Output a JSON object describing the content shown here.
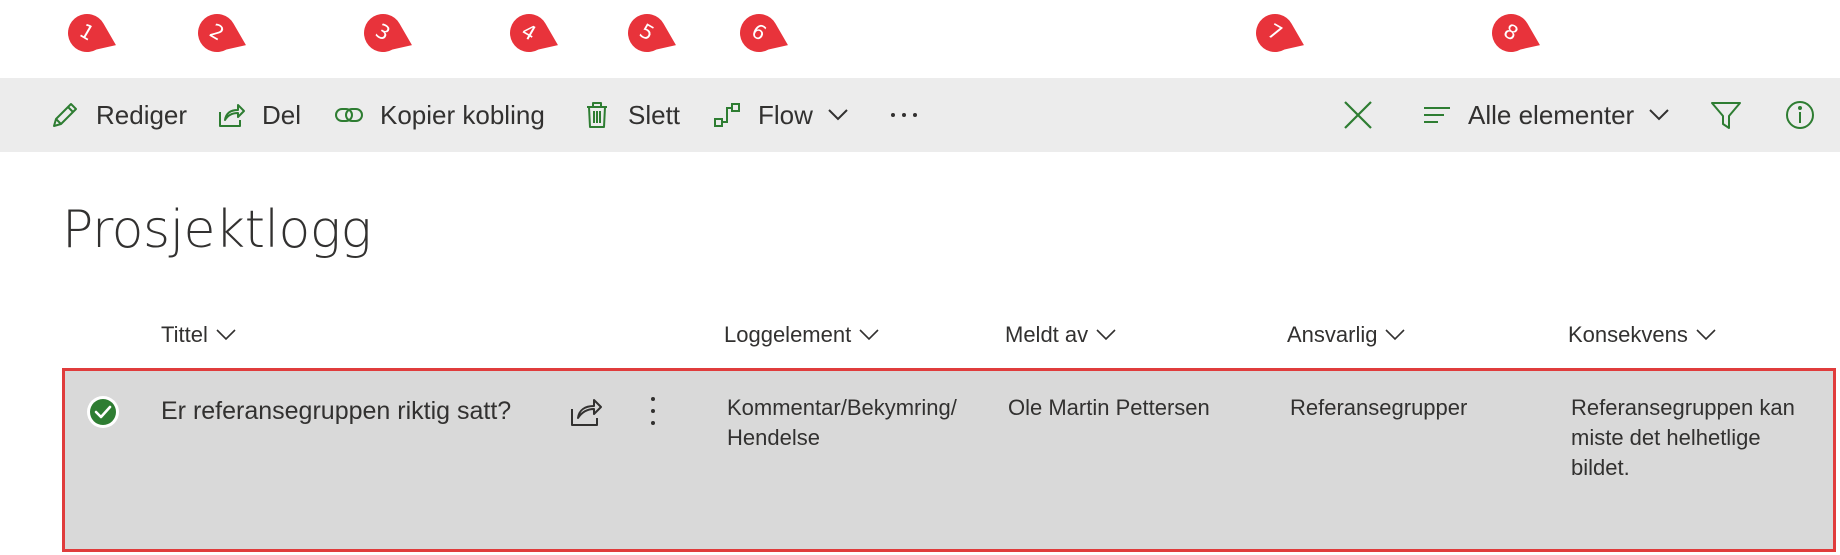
{
  "callouts": [
    "1",
    "2",
    "3",
    "4",
    "5",
    "6",
    "7",
    "8"
  ],
  "commands": {
    "edit": "Rediger",
    "share": "Del",
    "copy_link": "Kopier kobling",
    "delete": "Slett",
    "flow": "Flow",
    "view": "Alle elementer"
  },
  "page_title": "Prosjektlogg",
  "columns": [
    "Tittel",
    "Loggelement",
    "Meldt av",
    "Ansvarlig",
    "Konsekvens"
  ],
  "row": {
    "title": "Er referansegruppen riktig satt?",
    "loggelement_line1": "Kommentar/Bekymring/",
    "loggelement_line2": "Hendelse",
    "meldt_av": "Ole Martin Pettersen",
    "ansvarlig": "Referansegrupper",
    "konsekvens_line1": "Referansegruppen kan",
    "konsekvens_line2": "miste det helhetlige",
    "konsekvens_line3": "bildet."
  },
  "colors": {
    "accent": "#2e7d32",
    "callout": "#e8333b",
    "selected_row": "#d9d9d9",
    "highlight_border": "#e03c3c",
    "command_bar": "#ececec"
  },
  "icons": [
    "pencil-icon",
    "share-icon",
    "link-icon",
    "trash-icon",
    "flow-icon",
    "more-icon",
    "close-icon",
    "view-lines-icon",
    "filter-icon",
    "info-icon",
    "check-circle-icon"
  ]
}
